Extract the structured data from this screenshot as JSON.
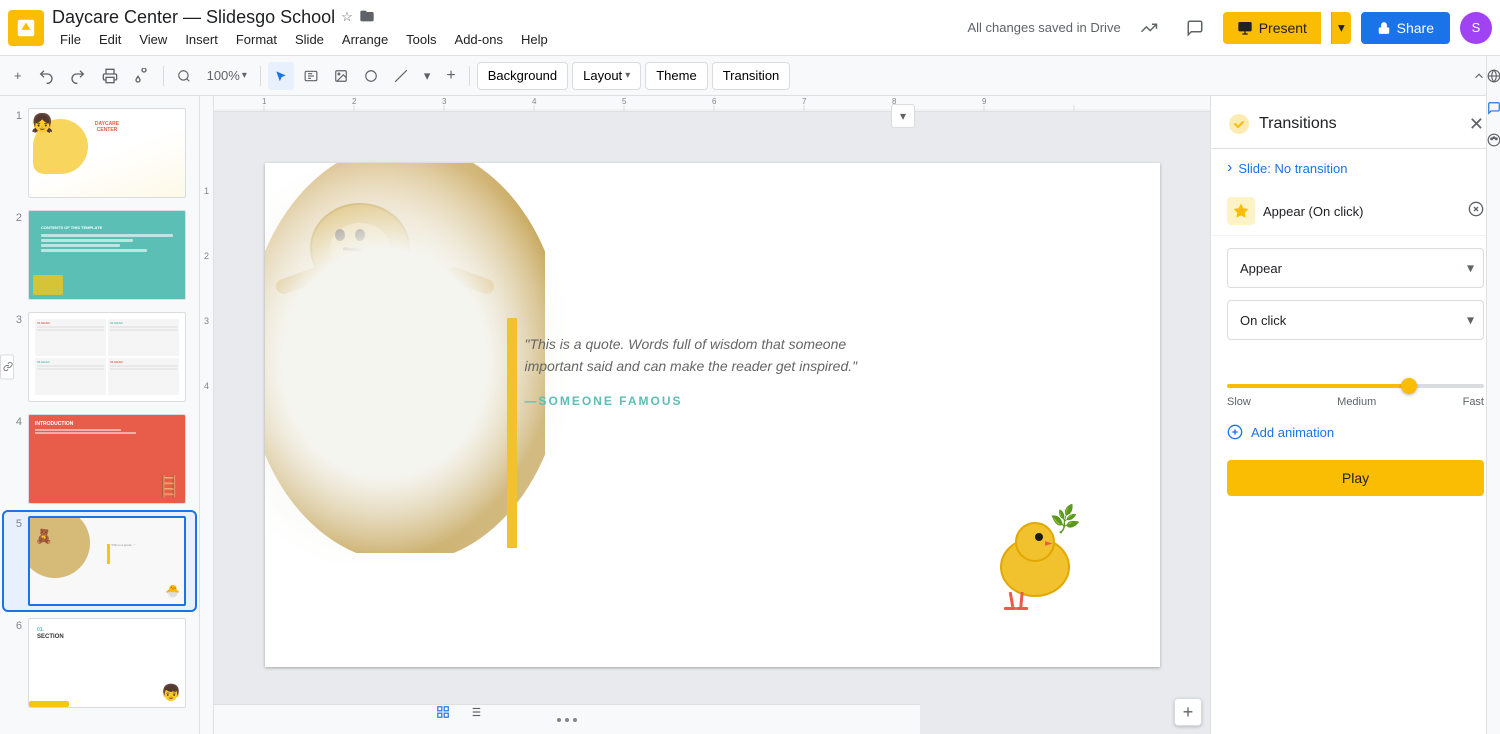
{
  "app": {
    "icon_color": "#FBBC04",
    "title": "Daycare Center — Slidesgo School",
    "star_icon": "☆",
    "folder_icon": "📁"
  },
  "menu": {
    "items": [
      "File",
      "Edit",
      "View",
      "Insert",
      "Format",
      "Slide",
      "Arrange",
      "Tools",
      "Add-ons",
      "Help"
    ]
  },
  "autosave": "All changes saved in Drive",
  "toolbar": {
    "zoom_value": "100%",
    "background_label": "Background",
    "layout_label": "Layout",
    "theme_label": "Theme",
    "transition_label": "Transition"
  },
  "header_right": {
    "present_label": "Present",
    "share_label": "Share",
    "share_icon": "🔒"
  },
  "slides": [
    {
      "num": "1",
      "type": "title"
    },
    {
      "num": "2",
      "type": "contents"
    },
    {
      "num": "3",
      "type": "info"
    },
    {
      "num": "4",
      "type": "intro"
    },
    {
      "num": "5",
      "type": "quote",
      "active": true
    },
    {
      "num": "6",
      "type": "section"
    }
  ],
  "canvas": {
    "quote_bar_color": "#F2C12E",
    "quote_text": "\"This is a quote. Words full of wisdom that someone important said and can make the reader get inspired.\"",
    "quote_author": "—SOMEONE FAMOUS",
    "author_color": "#5bbfb5"
  },
  "transitions_panel": {
    "title": "Transitions",
    "close_icon": "✕",
    "slide_transition": {
      "label": "Slide: No transition",
      "expand_icon": "›"
    },
    "animation_item": {
      "icon": "✦",
      "label": "Appear  (On click)",
      "delete_icon": "✕"
    },
    "appear_label": "Appear",
    "on_click_label": "On click",
    "speed": {
      "slow_label": "Slow",
      "medium_label": "Medium",
      "fast_label": "Fast",
      "value": 72
    },
    "add_animation_label": "Add animation",
    "play_label": "Play"
  },
  "right_extras": {
    "icons": [
      "📊",
      "💬",
      "🎨"
    ]
  },
  "numbers": [
    "1",
    "2",
    "3",
    "4"
  ],
  "bottom_dots": [
    1,
    2,
    3
  ]
}
